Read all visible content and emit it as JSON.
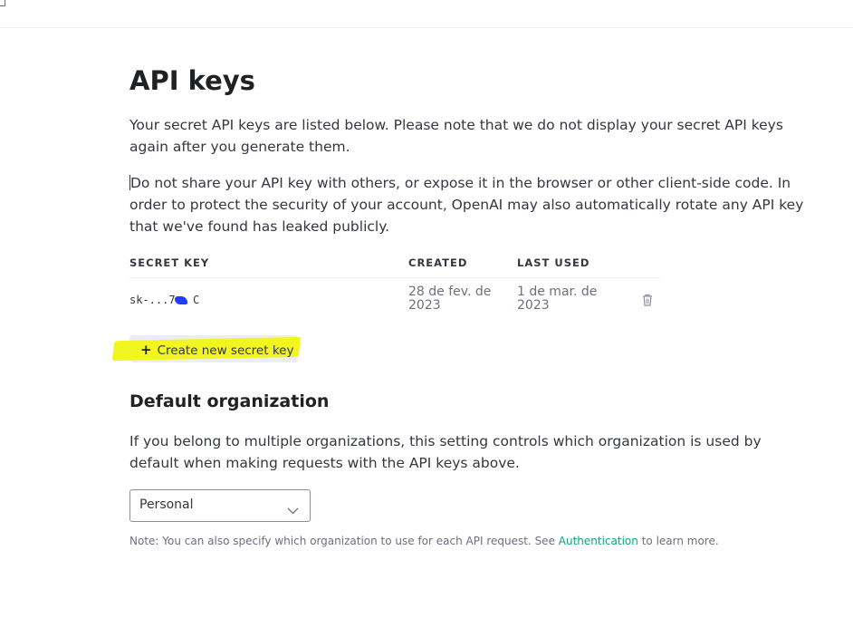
{
  "page": {
    "title": "API keys",
    "intro": "Your secret API keys are listed below. Please note that we do not display your secret API keys again after you generate them.",
    "warning": "Do not share your API key with others, or expose it in the browser or other client-side code. In order to protect the security of your account, OpenAI may also automatically rotate any API key that we've found has leaked publicly."
  },
  "keys_table": {
    "headers": {
      "secret_key": "SECRET KEY",
      "created": "CREATED",
      "last_used": "LAST USED"
    },
    "rows": [
      {
        "key_prefix": "sk-...7",
        "key_suffix": "C",
        "created": "28 de fev. de 2023",
        "last_used": "1 de mar. de 2023",
        "delete_icon": "trash-icon"
      }
    ]
  },
  "create_button": {
    "icon": "plus-icon",
    "label": "Create new secret key",
    "highlight_color": "#f1f620"
  },
  "default_org": {
    "title": "Default organization",
    "description": "If you belong to multiple organizations, this setting controls which organization is used by default when making requests with the API keys above.",
    "selected": "Personal",
    "note_prefix": "Note: You can also specify which organization to use for each API request. See",
    "note_link": "Authentication",
    "note_suffix": "to learn more.",
    "link_color": "#10a37f"
  }
}
